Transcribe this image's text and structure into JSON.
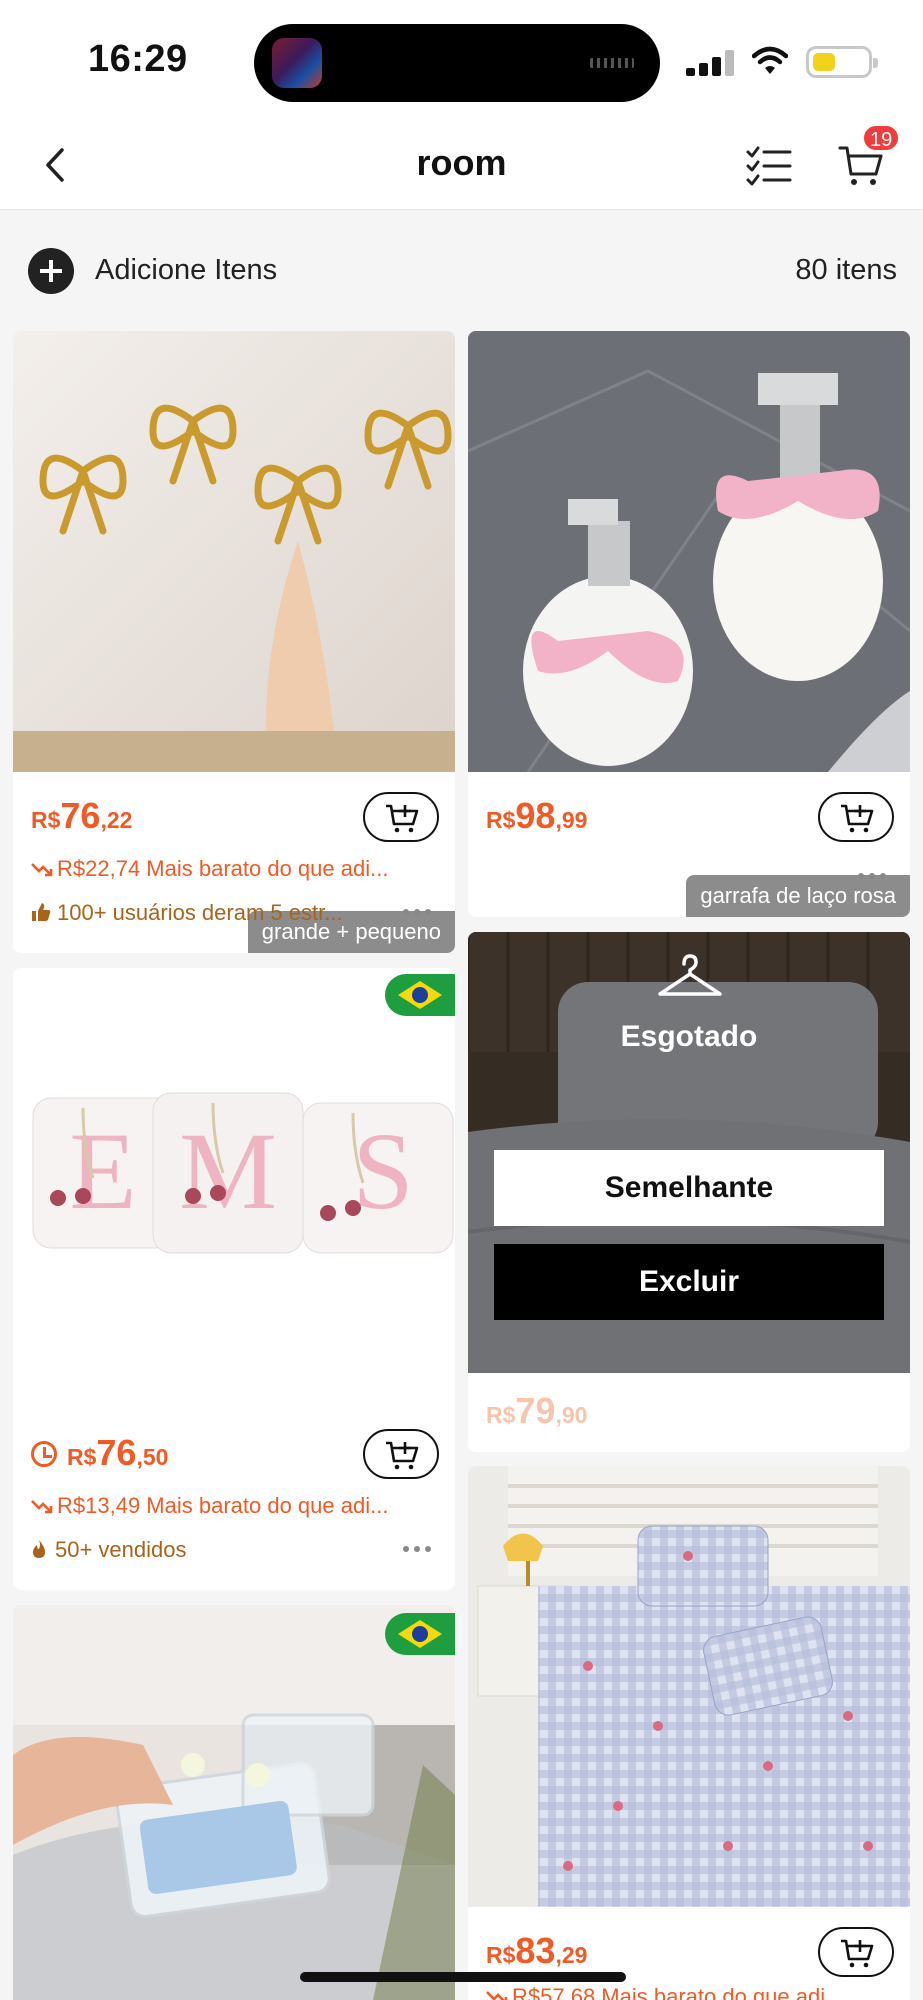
{
  "status": {
    "time": "16:29",
    "cart_badge": "19"
  },
  "nav": {
    "title": "room"
  },
  "header": {
    "add_label": "Adicione Itens",
    "count": "80 itens"
  },
  "products": [
    {
      "variant": "grande + pequeno",
      "currency": "R$",
      "price_int": "76",
      "price_dec": ",22",
      "cheaper": "R$22,74 Mais barato do que adi...",
      "social": "100+ usuários deram 5 estr..."
    },
    {
      "variant": "garrafa de laço rosa",
      "currency": "R$",
      "price_int": "98",
      "price_dec": ",99"
    },
    {
      "currency": "R$",
      "price_int": "76",
      "price_dec": ",50",
      "cheaper": "R$13,49 Mais barato do que adi...",
      "social": "50+ vendidos"
    },
    {
      "sold_out": "Esgotado",
      "similar": "Semelhante",
      "delete": "Excluir",
      "currency": "R$",
      "price_int": "79",
      "price_dec": ",90"
    },
    {
      "currency": "R$",
      "price_int": "83",
      "price_dec": ",29",
      "cheaper": "R$57,68 Mais barato do que adi..."
    },
    {}
  ],
  "colors": {
    "accent": "#f15a24",
    "social": "#a8641a",
    "badge": "#f03c3c"
  }
}
